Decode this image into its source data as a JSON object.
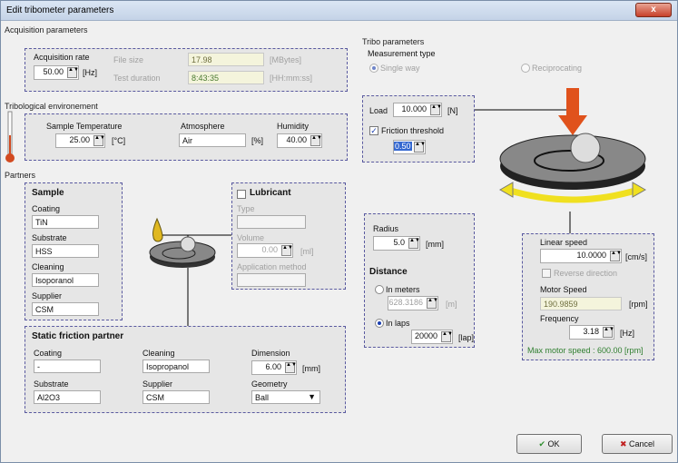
{
  "window": {
    "title": "Edit tribometer parameters",
    "close": "x"
  },
  "acq": {
    "group": "Acquisition parameters",
    "rate_label": "Acquisition rate",
    "rate_value": "50.00",
    "rate_unit": "[Hz]",
    "filesize_label": "File size",
    "filesize_value": "17.98",
    "filesize_unit": "[MBytes]",
    "duration_label": "Test duration",
    "duration_value": "8:43:35",
    "duration_unit": "[HH:mm:ss]"
  },
  "trib": {
    "group": "Tribological environement",
    "temp_label": "Sample Temperature",
    "temp_value": "25.00",
    "temp_unit": "[°C]",
    "atm_label": "Atmosphere",
    "atm_value": "Air",
    "atm_unit": "[%]",
    "hum_label": "Humidity",
    "hum_value": "40.00"
  },
  "partners": {
    "group": "Partners"
  },
  "sample": {
    "title": "Sample",
    "coating_label": "Coating",
    "coating_value": "TiN",
    "substrate_label": "Substrate",
    "substrate_value": "HSS",
    "cleaning_label": "Cleaning",
    "cleaning_value": "Isoporanol",
    "supplier_label": "Supplier",
    "supplier_value": "CSM"
  },
  "lubricant": {
    "title": "Lubricant",
    "type_label": "Type",
    "type_value": "",
    "volume_label": "Volume",
    "volume_value": "0.00",
    "volume_unit": "[ml]",
    "method_label": "Application method",
    "method_value": ""
  },
  "static": {
    "title": "Static friction partner",
    "coating_label": "Coating",
    "coating_value": "-",
    "cleaning_label": "Cleaning",
    "cleaning_value": "Isopropanol",
    "dimension_label": "Dimension",
    "dimension_value": "6.00",
    "dimension_unit": "[mm]",
    "substrate_label": "Substrate",
    "substrate_value": "Al2O3",
    "supplier_label": "Supplier",
    "supplier_value": "CSM",
    "geometry_label": "Geometry",
    "geometry_value": "Ball"
  },
  "tribo": {
    "group": "Tribo parameters",
    "mtype_label": "Measurement type",
    "single": "Single way",
    "recip": "Reciprocating",
    "load_label": "Load",
    "load_value": "10.000",
    "load_unit": "[N]",
    "friction_label": "Friction threshold",
    "friction_value": "0.50"
  },
  "dist": {
    "radius_label": "Radius",
    "radius_value": "5.0",
    "radius_unit": "[mm]",
    "title": "Distance",
    "meters_label": "In meters",
    "meters_value": "628.3186",
    "meters_unit": "[m]",
    "laps_label": "In laps",
    "laps_value": "20000",
    "laps_unit": "[lap]"
  },
  "speed": {
    "linear_label": "Linear speed",
    "linear_value": "10.0000",
    "linear_unit": "[cm/s]",
    "reverse_label": "Reverse direction",
    "motor_label": "Motor Speed",
    "motor_value": "190.9859",
    "motor_unit": "[rpm]",
    "freq_label": "Frequency",
    "freq_value": "3.18",
    "freq_unit": "[Hz]",
    "max_label": "Max motor speed : 600.00 [rpm]"
  },
  "buttons": {
    "ok": "OK",
    "cancel": "Cancel"
  },
  "colors": {
    "accent": "#1a3fb0",
    "arrow": "#e0521c",
    "green": "#2f7f2f",
    "ring": "#f0e020"
  }
}
